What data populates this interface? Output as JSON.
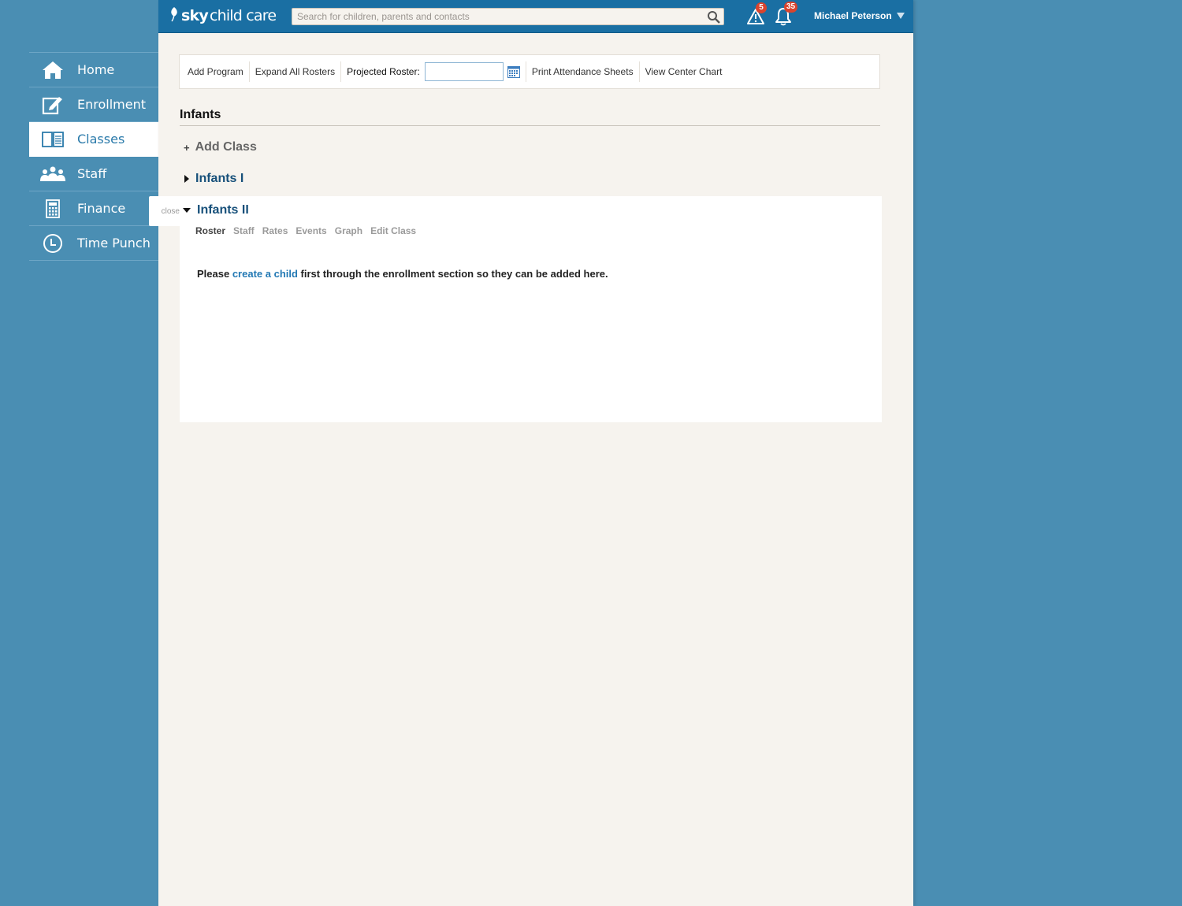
{
  "app": {
    "logo_prefix": "sky",
    "logo_suffix": "child care",
    "brand_color": "#1a6fa3",
    "background_color": "#4a8eb3"
  },
  "header": {
    "search_placeholder": "Search for children, parents and contacts",
    "alerts_count": "5",
    "notifications_count": "35",
    "user_name": "Michael Peterson"
  },
  "sidebar": {
    "items": [
      {
        "label": "Home",
        "icon": "home-icon",
        "active": false
      },
      {
        "label": "Enrollment",
        "icon": "enrollment-icon",
        "active": false
      },
      {
        "label": "Classes",
        "icon": "book-icon",
        "active": true
      },
      {
        "label": "Staff",
        "icon": "staff-icon",
        "active": false
      },
      {
        "label": "Finance",
        "icon": "calculator-icon",
        "active": false
      },
      {
        "label": "Time Punch",
        "icon": "clock-icon",
        "active": false
      }
    ]
  },
  "toolbar": {
    "add_program": "Add Program",
    "expand_all": "Expand All Rosters",
    "projected_roster_label": "Projected Roster:",
    "projected_roster_value": "",
    "print_sheets": "Print Attendance Sheets",
    "center_chart": "View Center Chart"
  },
  "program": {
    "title": "Infants",
    "add_class_label": "Add Class",
    "classes": [
      {
        "name": "Infants I",
        "expanded": false
      },
      {
        "name": "Infants II",
        "expanded": true
      }
    ],
    "close_label": "close",
    "subtabs": [
      "Roster",
      "Staff",
      "Rates",
      "Events",
      "Graph",
      "Edit Class"
    ],
    "active_subtab": "Roster",
    "message_before": "Please ",
    "message_link": "create a child",
    "message_after": " first through the enrollment section so they can be added here."
  }
}
